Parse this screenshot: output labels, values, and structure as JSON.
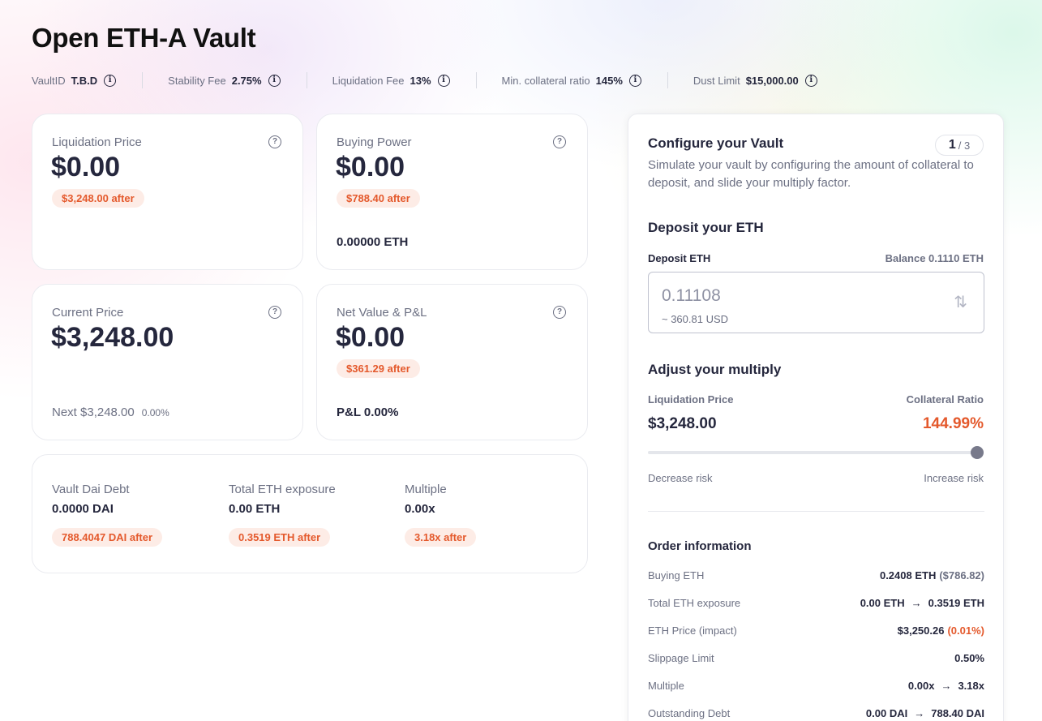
{
  "page_title": "Open ETH-A Vault",
  "stats": [
    {
      "label": "VaultID",
      "value": "T.B.D"
    },
    {
      "label": "Stability Fee",
      "value": "2.75%"
    },
    {
      "label": "Liquidation Fee",
      "value": "13%"
    },
    {
      "label": "Min. collateral ratio",
      "value": "145%"
    },
    {
      "label": "Dust Limit",
      "value": "$15,000.00"
    }
  ],
  "cards": {
    "liquidation_price": {
      "label": "Liquidation Price",
      "value": "$0.00",
      "after": "$3,248.00 after"
    },
    "buying_power": {
      "label": "Buying Power",
      "value": "$0.00",
      "after": "$788.40 after",
      "eth": "0.00000 ETH"
    },
    "current_price": {
      "label": "Current Price",
      "value": "$3,248.00",
      "next_label": "Next $3,248.00",
      "next_change": "0.00%"
    },
    "net_value": {
      "label": "Net Value & P&L",
      "value": "$0.00",
      "after": "$361.29 after",
      "pnl": "P&L 0.00%"
    }
  },
  "summary": [
    {
      "label": "Vault Dai Debt",
      "value": "0.0000 DAI",
      "after": "788.4047 DAI after"
    },
    {
      "label": "Total ETH exposure",
      "value": "0.00 ETH",
      "after": "0.3519 ETH after"
    },
    {
      "label": "Multiple",
      "value": "0.00x",
      "after": "3.18x after"
    }
  ],
  "panel": {
    "title": "Configure your Vault",
    "step_current": "1",
    "step_total": "/ 3",
    "description": "Simulate your vault by configuring the amount of collateral to deposit, and slide your multiply factor.",
    "deposit": {
      "heading": "Deposit your ETH",
      "label": "Deposit ETH",
      "balance": "Balance 0.1110 ETH",
      "amount": "0.11108",
      "usd": "~ 360.81 USD"
    },
    "multiply": {
      "heading": "Adjust your multiply",
      "liq_label": "Liquidation Price",
      "liq_value": "$3,248.00",
      "ratio_label": "Collateral Ratio",
      "ratio_value": "144.99%",
      "decrease": "Decrease risk",
      "increase": "Increase risk",
      "slider_position": 1.0
    },
    "order": {
      "heading": "Order information",
      "rows": [
        {
          "key": "Buying ETH",
          "value": "0.2408 ETH",
          "extra": "($786.82)"
        },
        {
          "key": "Total ETH exposure",
          "from": "0.00 ETH",
          "to": "0.3519 ETH"
        },
        {
          "key": "ETH Price (impact)",
          "value": "$3,250.26",
          "extra": "(0.01%)"
        },
        {
          "key": "Slippage Limit",
          "value": "0.50%"
        },
        {
          "key": "Multiple",
          "from": "0.00x",
          "to": "3.18x"
        },
        {
          "key": "Outstanding Debt",
          "from": "0.00 DAI",
          "to": "788.40 DAI"
        }
      ]
    }
  },
  "colors": {
    "accent_orange": "#e4592c",
    "pill_bg": "#fdece6",
    "text_dark": "#25273d",
    "text_muted": "#6c7083"
  }
}
